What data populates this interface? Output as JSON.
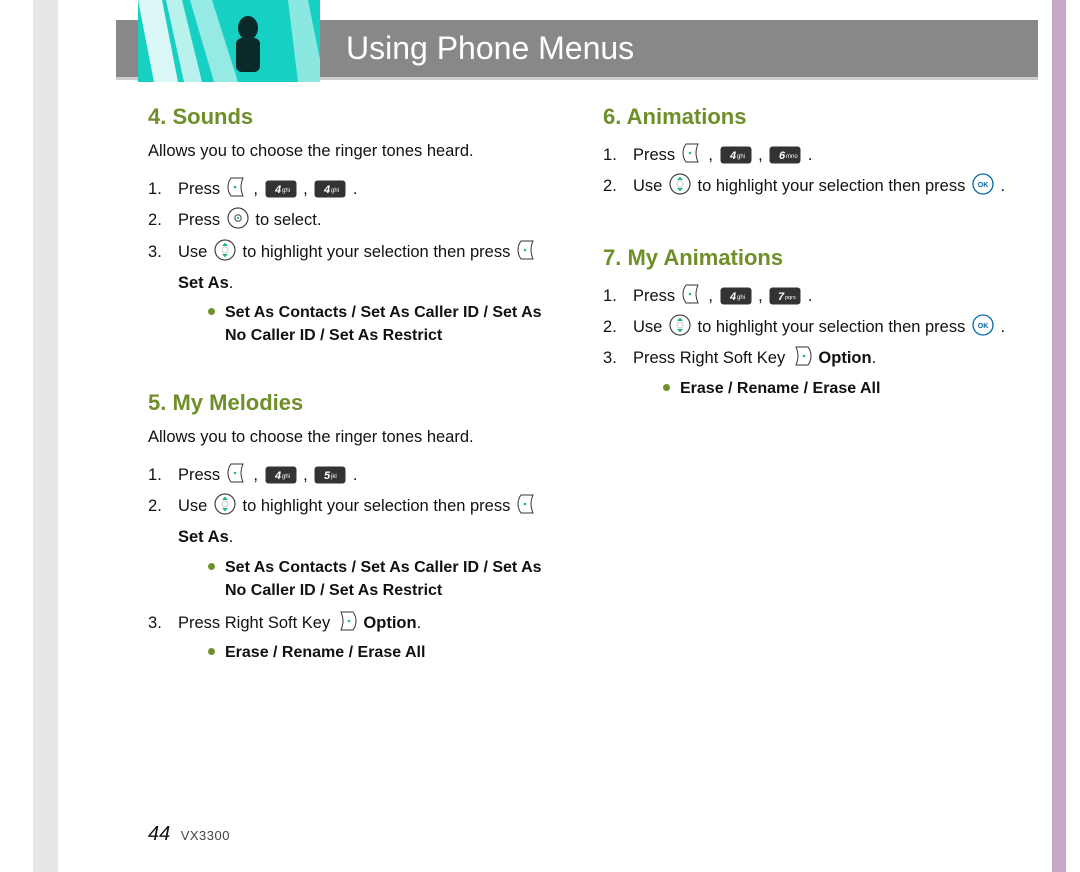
{
  "header": {
    "title": "Using Phone Menus"
  },
  "footer": {
    "page": "44",
    "model": "VX3300"
  },
  "left": {
    "sounds": {
      "title": "4. Sounds",
      "desc": "Allows you to choose the ringer tones heard.",
      "step1_press": "Press",
      "step2_pre": "Press",
      "step2_post": "to select.",
      "step3_pre": "Use",
      "step3_mid": "to highlight your selection then press",
      "step3_bold": "Set As",
      "bullet": "Set As Contacts / Set As Caller ID / Set As No Caller ID / Set As Restrict"
    },
    "melodies": {
      "title": "5. My Melodies",
      "desc": "Allows you to choose the ringer tones heard.",
      "step1_press": "Press",
      "step2_pre": "Use",
      "step2_mid": "to highlight your selection then press",
      "step2_bold": "Set As",
      "bullet1": "Set As Contacts / Set As Caller ID / Set As No Caller ID / Set As Restrict",
      "step3_pre": "Press Right  Soft Key",
      "step3_bold": "Option",
      "bullet2": "Erase / Rename / Erase All"
    }
  },
  "right": {
    "animations": {
      "title": "6. Animations",
      "step1_press": "Press",
      "step2_pre": "Use",
      "step2_mid": "to highlight your selection then press"
    },
    "myanim": {
      "title": "7. My Animations",
      "step1_press": "Press",
      "step2_pre": "Use",
      "step2_mid": "to highlight your selection then press",
      "step3_pre": "Press Right  Soft Key",
      "step3_bold": "Option",
      "bullet": "Erase / Rename / Erase All"
    }
  },
  "keys": {
    "4": {
      "num": "4",
      "letters": "ghi"
    },
    "5": {
      "num": "5",
      "letters": "jkl"
    },
    "6": {
      "num": "6",
      "letters": "mno"
    },
    "7": {
      "num": "7",
      "letters": "pqrs"
    }
  }
}
